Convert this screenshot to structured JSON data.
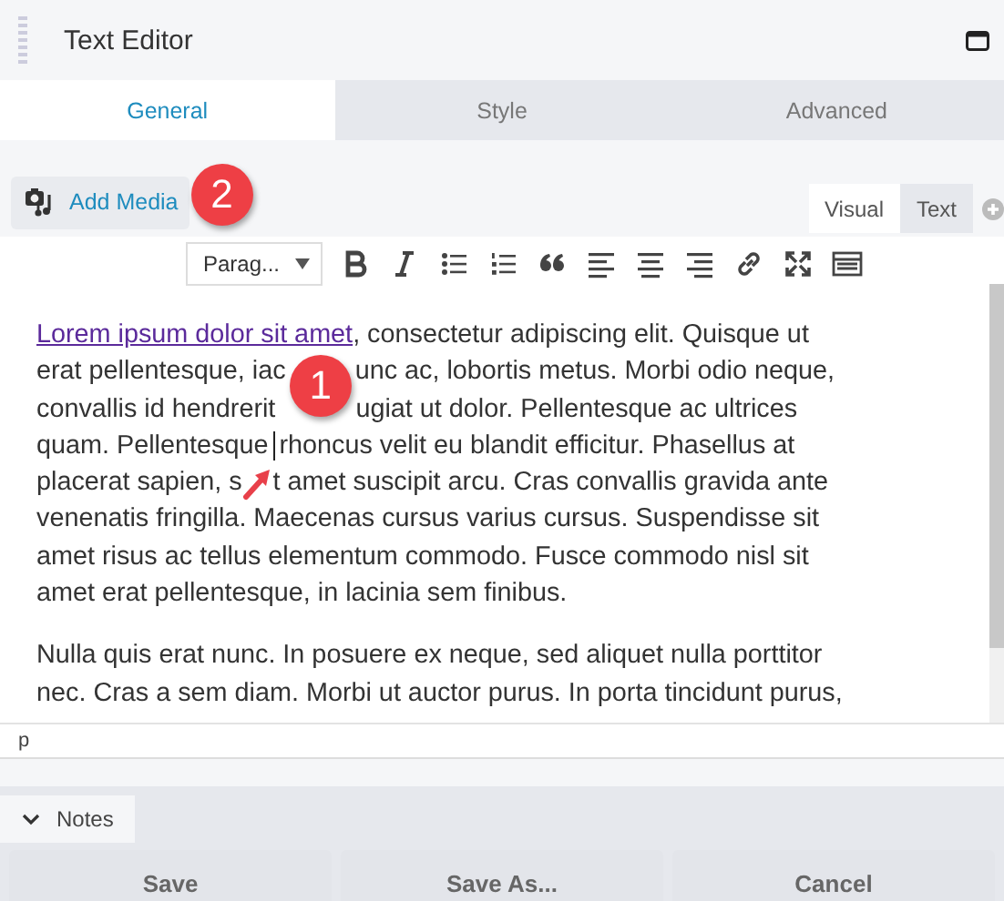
{
  "panel": {
    "title": "Text Editor"
  },
  "tabs": [
    {
      "label": "General",
      "selected": true
    },
    {
      "label": "Style",
      "selected": false
    },
    {
      "label": "Advanced",
      "selected": false
    }
  ],
  "media_button": "Add Media",
  "mode_tabs": [
    {
      "label": "Visual",
      "selected": true
    },
    {
      "label": "Text",
      "selected": false
    }
  ],
  "format_select": "Parag...",
  "content": [
    {
      "lines": [
        [
          {
            "kind": "link",
            "text": "Lorem ipsum dolor sit amet"
          },
          {
            "kind": "text",
            "text": ", consectetur adipiscing elit. Quisque ut"
          }
        ],
        [
          {
            "kind": "text",
            "text": "erat pellentesque, iac"
          },
          {
            "kind": "text",
            "text": "unc ac, lobortis metus. Morbi odio neque,"
          }
        ],
        [
          {
            "kind": "text",
            "text": "convallis id hendrerit"
          },
          {
            "kind": "text",
            "text": "ugiat ut dolor. Pellentesque ac ultrices"
          }
        ],
        [
          {
            "kind": "text",
            "text": "quam. Pellentesque"
          },
          {
            "kind": "text",
            "text": "rhoncus velit eu blandit efficitur. Phasellus at"
          }
        ],
        [
          {
            "kind": "text",
            "text": "placerat sapien, s"
          },
          {
            "kind": "text",
            "text": "t amet suscipit arcu. Cras convallis gravida ante"
          }
        ],
        [
          {
            "kind": "text",
            "text": "venenatis fringilla. Maecenas cursus varius cursus. Suspendisse sit"
          }
        ],
        [
          {
            "kind": "text",
            "text": "amet risus ac tellus elementum commodo. Fusce commodo nisl sit"
          }
        ],
        [
          {
            "kind": "text",
            "text": "amet erat pellentesque, in lacinia sem finibus."
          }
        ]
      ]
    },
    {
      "lines": [
        [
          {
            "kind": "text",
            "text": "Nulla quis erat nunc. In posuere ex neque, sed aliquet nulla porttitor"
          }
        ],
        [
          {
            "kind": "text",
            "text": "nec. Cras a sem diam. Morbi ut auctor purus. In porta tincidunt purus,"
          }
        ]
      ]
    }
  ],
  "path": "p",
  "notes": {
    "label": "Notes",
    "expanded": false
  },
  "buttons": [
    "Save",
    "Save As...",
    "Cancel"
  ],
  "callouts": [
    "1",
    "2"
  ]
}
